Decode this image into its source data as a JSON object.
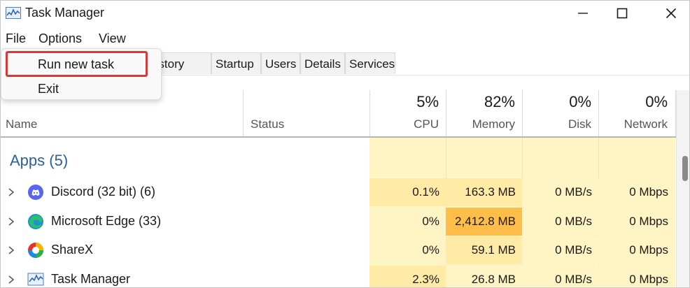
{
  "window": {
    "title": "Task Manager"
  },
  "menu": {
    "file": "File",
    "options": "Options",
    "view": "View"
  },
  "file_menu": {
    "items": [
      "Run new task",
      "Exit"
    ],
    "highlighted": "Run new task",
    "highlight_color": "#d43c3c"
  },
  "tabs": [
    "p history",
    "Startup",
    "Users",
    "Details",
    "Services"
  ],
  "columns": {
    "name": "Name",
    "status": "Status",
    "cpu": {
      "pct": "5%",
      "label": "CPU"
    },
    "memory": {
      "pct": "82%",
      "label": "Memory"
    },
    "disk": {
      "pct": "0%",
      "label": "Disk"
    },
    "network": {
      "pct": "0%",
      "label": "Network"
    }
  },
  "group": {
    "title": "Apps (5)"
  },
  "rows": [
    {
      "name": "Discord (32 bit) (6)",
      "icon": "discord-icon",
      "cpu": "0.1%",
      "memory": "163.3 MB",
      "disk": "0 MB/s",
      "network": "0 Mbps"
    },
    {
      "name": "Microsoft Edge (33)",
      "icon": "edge-icon",
      "cpu": "0%",
      "memory": "2,412.8 MB",
      "disk": "0 MB/s",
      "network": "0 Mbps"
    },
    {
      "name": "ShareX",
      "icon": "sharex-icon",
      "cpu": "0%",
      "memory": "59.1 MB",
      "disk": "0 MB/s",
      "network": "0 Mbps"
    },
    {
      "name": "Task Manager",
      "icon": "task-manager-icon",
      "cpu": "2.3%",
      "memory": "26.8 MB",
      "disk": "0 MB/s",
      "network": "0 Mbps"
    }
  ],
  "colors": {
    "heat_light": "#fff4c4",
    "heat_medium": "#ffeaa6",
    "heat_hot": "#ffbd4a",
    "group_title": "#2b5f9e"
  }
}
